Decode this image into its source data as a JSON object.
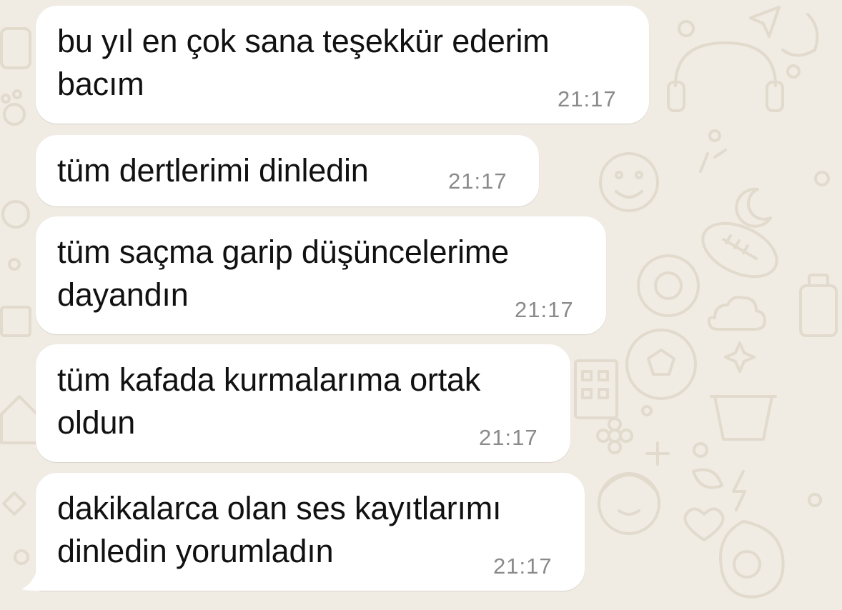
{
  "chat": {
    "messages": [
      {
        "text": "bu yıl en çok sana teşekkür ederim\nbacım",
        "time": "21:17"
      },
      {
        "text": "tüm dertlerimi dinledin",
        "time": "21:17"
      },
      {
        "text": "tüm saçma garip düşüncelerime\ndayandın",
        "time": "21:17"
      },
      {
        "text": "tüm kafada kurmalarıma ortak\noldun",
        "time": "21:17"
      },
      {
        "text": "dakikalarca olan ses kayıtlarımı\ndinledin yorumladın",
        "time": "21:17"
      }
    ]
  },
  "colors": {
    "wallpaper": "#f0ebe3",
    "wallpaper_doodle": "#e3dccf",
    "bubble": "#ffffff",
    "text": "#111111",
    "timestamp": "#8a8a8a"
  },
  "icons": {
    "wallpaper_doodles": [
      "heart-icon",
      "cloud-icon",
      "star-icon",
      "moon-icon",
      "smiley-icon",
      "ball-icon",
      "plus-icon",
      "pot-icon"
    ]
  }
}
